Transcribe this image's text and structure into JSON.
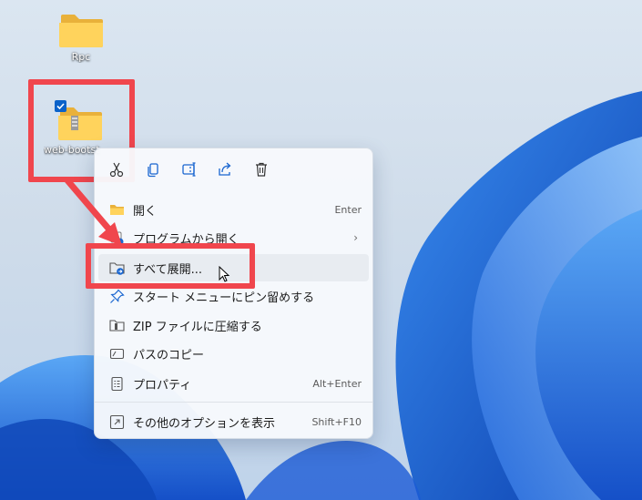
{
  "desktop": {
    "icons": [
      {
        "label": "Rpc"
      },
      {
        "label": "web-bootst"
      }
    ]
  },
  "context_menu": {
    "toolbar": [
      "cut-icon",
      "copy-icon",
      "rename-icon",
      "share-icon",
      "delete-icon"
    ],
    "items": [
      {
        "label": "開く",
        "shortcut": "Enter",
        "icon": "folder-icon"
      },
      {
        "label": "プログラムから開く",
        "shortcut": "",
        "icon": "open-with-icon",
        "submenu": "›"
      },
      {
        "label": "すべて展開...",
        "shortcut": "",
        "icon": "extract-icon"
      },
      {
        "label": "スタート メニューにピン留めする",
        "shortcut": "",
        "icon": "pin-icon"
      },
      {
        "label": "ZIP ファイルに圧縮する",
        "shortcut": "",
        "icon": "zip-icon"
      },
      {
        "label": "パスのコピー",
        "shortcut": "",
        "icon": "copy-path-icon"
      },
      {
        "label": "プロパティ",
        "shortcut": "Alt+Enter",
        "icon": "properties-icon"
      },
      {
        "label": "その他のオプションを表示",
        "shortcut": "Shift+F10",
        "icon": "more-options-icon"
      }
    ]
  },
  "colors": {
    "highlight": "#f0464d",
    "accent": "#0a62c9",
    "wallpaper_blue": "#1565d8"
  }
}
